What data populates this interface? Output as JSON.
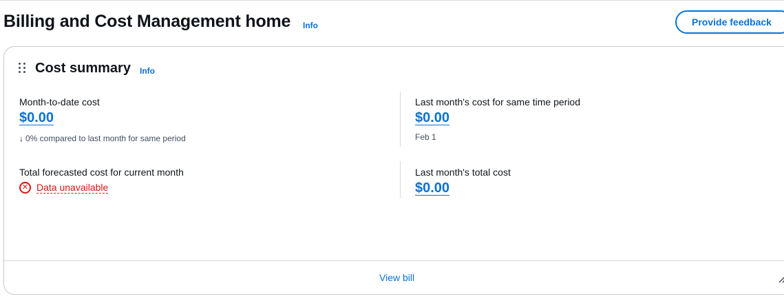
{
  "header": {
    "title": "Billing and Cost Management home",
    "info_label": "Info",
    "feedback_label": "Provide feedback"
  },
  "cost_summary": {
    "title": "Cost summary",
    "info_label": "Info",
    "month_to_date": {
      "label": "Month-to-date cost",
      "value": "$0.00",
      "comparison": "0% compared to last month for same period",
      "arrow_icon": "arrow-down-icon"
    },
    "last_month_same_period": {
      "label": "Last month's cost for same time period",
      "value": "$0.00",
      "date": "Feb 1"
    },
    "forecast": {
      "label": "Total forecasted cost for current month",
      "status": "Data unavailable",
      "status_icon": "error-icon"
    },
    "last_month_total": {
      "label": "Last month's total cost",
      "value": "$0.00"
    },
    "footer_link": "View bill"
  },
  "colors": {
    "link": "#0972d3",
    "error": "#d91515",
    "text": "#0f141a",
    "border": "#c6c6cd"
  }
}
